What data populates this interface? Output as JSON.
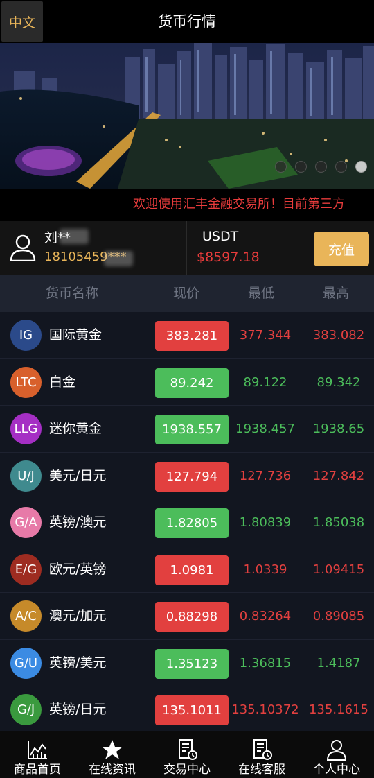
{
  "header": {
    "lang_button": "中文",
    "title": "货币行情"
  },
  "banner": {
    "slides": 5,
    "active_slide": 5
  },
  "marquee": {
    "text": "欢迎使用汇丰金融交易所！目前第三方"
  },
  "account": {
    "user_name": "刘**",
    "phone": "18105459***",
    "currency_label": "USDT",
    "balance": "$8597.18",
    "recharge_label": "充值"
  },
  "table": {
    "headers": {
      "name": "货币名称",
      "price": "现价",
      "low": "最低",
      "high": "最高"
    },
    "rows": [
      {
        "code": "IG",
        "name": "国际黄金",
        "price": "383.281",
        "low": "377.344",
        "high": "383.082",
        "trend": "down",
        "badge_color": "#2b4a8a"
      },
      {
        "code": "LTC",
        "name": "白金",
        "price": "89.242",
        "low": "89.122",
        "high": "89.342",
        "trend": "up",
        "badge_color": "#d8602c"
      },
      {
        "code": "LLG",
        "name": "迷你黄金",
        "price": "1938.557",
        "low": "1938.457",
        "high": "1938.65",
        "trend": "up",
        "badge_color": "#a52fc4"
      },
      {
        "code": "U/J",
        "name": "美元/日元",
        "price": "127.794",
        "low": "127.736",
        "high": "127.842",
        "trend": "down",
        "badge_color": "#3f8a8e"
      },
      {
        "code": "G/A",
        "name": "英镑/澳元",
        "price": "1.82805",
        "low": "1.80839",
        "high": "1.85038",
        "trend": "up",
        "badge_color": "#e77aa8"
      },
      {
        "code": "E/G",
        "name": "欧元/英镑",
        "price": "1.0981",
        "low": "1.0339",
        "high": "1.09415",
        "trend": "down",
        "badge_color": "#9e2c21"
      },
      {
        "code": "A/C",
        "name": "澳元/加元",
        "price": "0.88298",
        "low": "0.83264",
        "high": "0.89085",
        "trend": "down",
        "badge_color": "#c68a2a"
      },
      {
        "code": "G/U",
        "name": "英镑/美元",
        "price": "1.35123",
        "low": "1.36815",
        "high": "1.4187",
        "trend": "up",
        "badge_color": "#3b8be3"
      },
      {
        "code": "G/J",
        "name": "英镑/日元",
        "price": "135.1011",
        "low": "135.10372",
        "high": "135.1615",
        "trend": "down",
        "badge_color": "#3a9a3e"
      }
    ]
  },
  "colors": {
    "up": "#4cbd5b",
    "down": "#e2403f",
    "accent": "#e9b559"
  },
  "nav": [
    {
      "label": "商品首页",
      "icon": "chart-icon"
    },
    {
      "label": "在线资讯",
      "icon": "star-icon"
    },
    {
      "label": "交易中心",
      "icon": "document-clock-icon"
    },
    {
      "label": "在线客服",
      "icon": "document-clock-icon"
    },
    {
      "label": "个人中心",
      "icon": "person-icon"
    }
  ]
}
